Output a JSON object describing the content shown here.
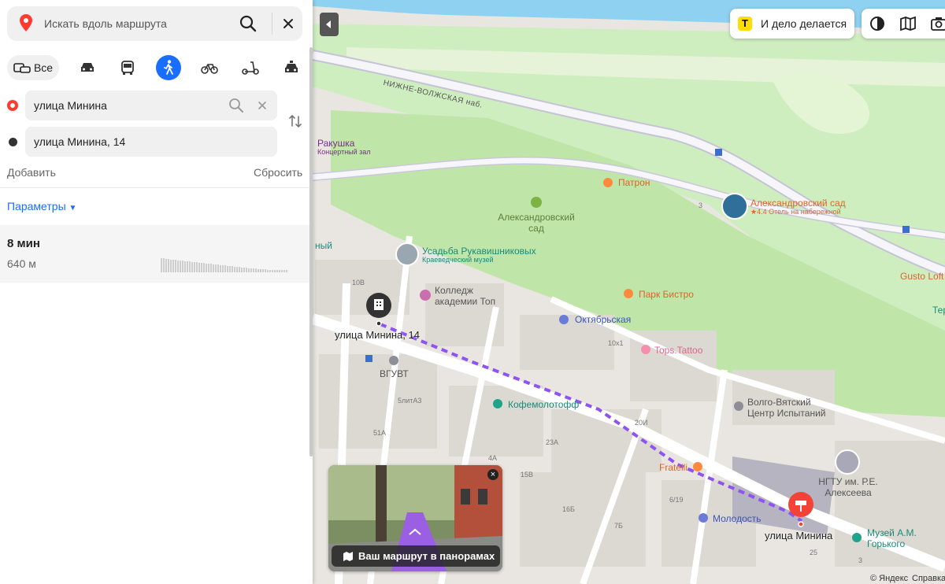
{
  "search": {
    "placeholder": "Искать вдоль маршрута"
  },
  "modes": [
    {
      "name": "all",
      "label": "Все",
      "selected": false
    },
    {
      "name": "car",
      "selected": false
    },
    {
      "name": "bus",
      "selected": false
    },
    {
      "name": "walk",
      "selected": true
    },
    {
      "name": "bike",
      "selected": false
    },
    {
      "name": "scooter",
      "selected": false
    },
    {
      "name": "taxi",
      "selected": false
    }
  ],
  "route": {
    "from": "улица Минина",
    "to": "улица Минина, 14",
    "add_label": "Добавить",
    "reset_label": "Сбросить",
    "params_label": "Параметры"
  },
  "result": {
    "time": "8 мин",
    "distance": "640 м"
  },
  "map": {
    "ad_label": "И дело делается",
    "pano_caption": "Ваш маршрут в панорамах",
    "copyright": "© Яндекс",
    "help": "Справка",
    "street": "НИЖНЕ-ВОЛЖСКАЯ наб.",
    "labels": {
      "rakushka": "Ракушка",
      "rakushka_sub": "Концертный зал",
      "patron": "Патрон",
      "alex_garden_park": "Александровский сад",
      "alex_hotel": "Александровский сад",
      "alex_hotel_sub": "★4.4 Отель на набережной",
      "usadba": "Усадьба Рукавишниковых",
      "usadba_sub": "Краеведческий музей",
      "college": "Колледж академии Топ",
      "park_bistro": "Парк Бистро",
      "gusto": "Gusto Loft",
      "oktyabrskaya": "Октябрьская",
      "tops_tattoo": "Tops.Tattoo",
      "vguvt": "ВГУВТ",
      "kofemolotoff": "Кофемолотофф",
      "volga_center": "Волго-Вятский Центр Испытаний",
      "fratelli": "Fratelli",
      "ngtu": "НГТУ им. Р.Е. Алексеева",
      "molodost": "Молодость",
      "muzey": "Музей А.М. Горького",
      "start_label": "улица Минина, 14",
      "end_label": "улица Минина",
      "edge_left": "ный",
      "edge_right": "Тер"
    },
    "house_numbers": [
      "3",
      "10В",
      "10х1",
      "5литА3",
      "20И",
      "51А",
      "23А",
      "4А",
      "15В",
      "16Б",
      "7Б",
      "6/19",
      "25",
      "3"
    ]
  }
}
